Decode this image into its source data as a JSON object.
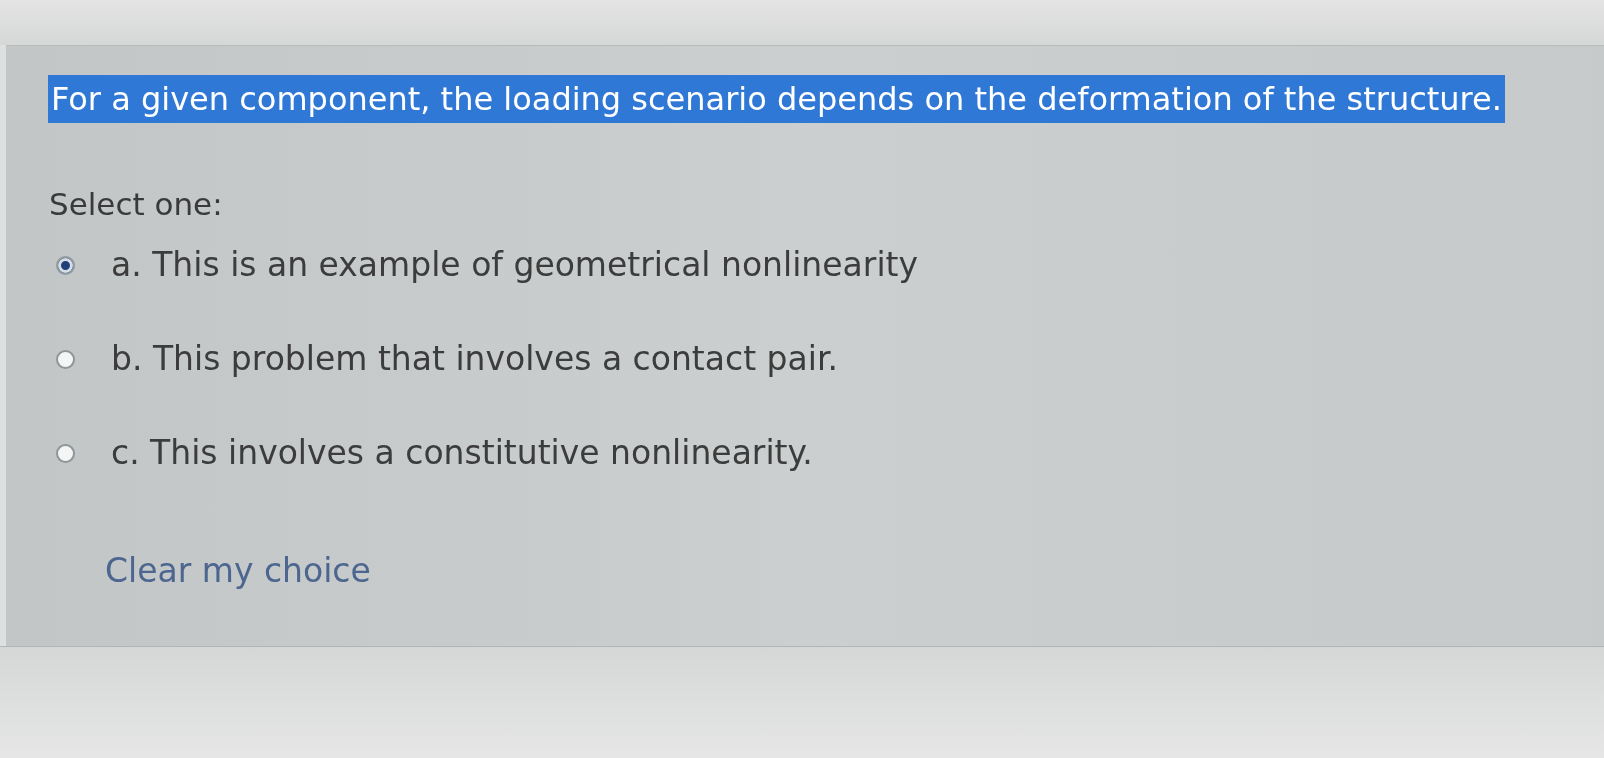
{
  "question": {
    "text": "For a given component, the loading scenario depends on the deformation of the structure.",
    "highlighted": true
  },
  "prompt": "Select one:",
  "options": [
    {
      "label": "a. This is an example of geometrical nonlinearity",
      "selected": true
    },
    {
      "label": "b. This problem that involves a contact pair.",
      "selected": false
    },
    {
      "label": "c. This involves a constitutive nonlinearity.",
      "selected": false
    }
  ],
  "clear_link": "Clear my choice"
}
